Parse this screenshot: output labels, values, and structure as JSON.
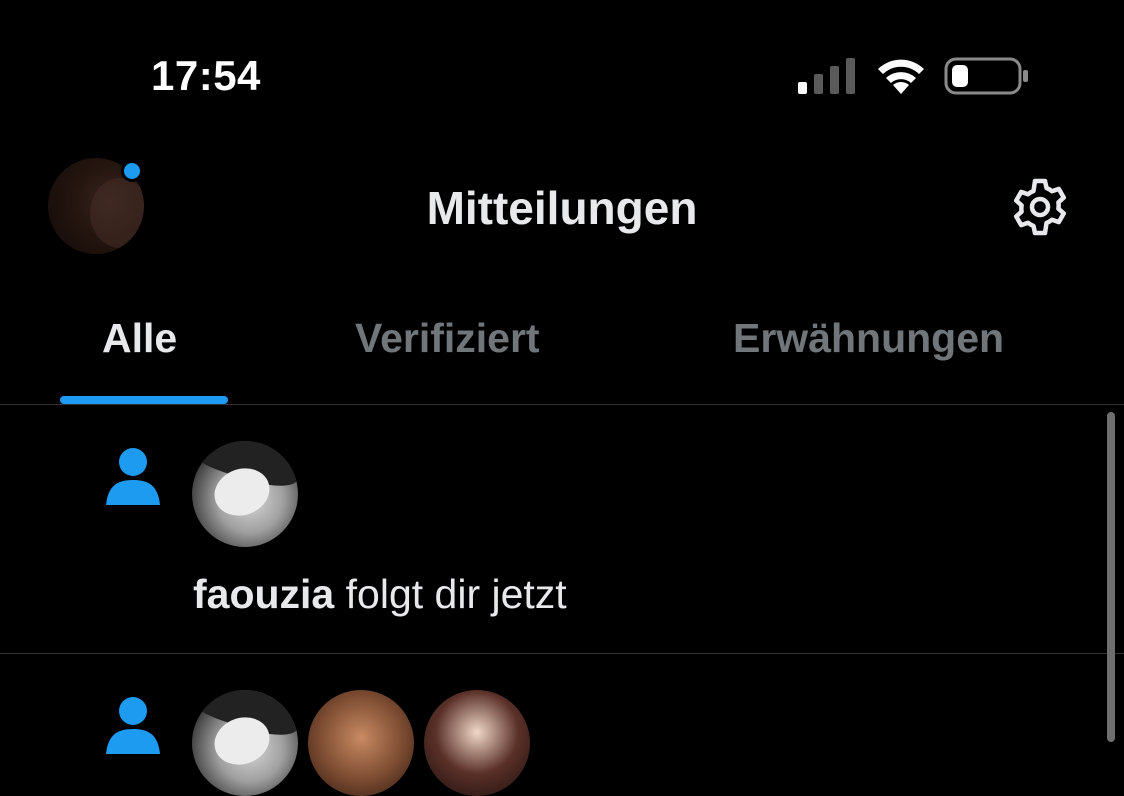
{
  "status_bar": {
    "time": "17:54",
    "signal_icon": "cellular-signal-icon",
    "wifi_icon": "wifi-icon",
    "battery_icon": "battery-icon",
    "battery_level": 0.2
  },
  "header": {
    "title": "Mitteilungen",
    "settings_icon": "gear-icon",
    "has_unread_dot": true
  },
  "tabs": [
    {
      "label": "Alle",
      "active": true
    },
    {
      "label": "Verifiziert",
      "active": false
    },
    {
      "label": "Erwähnungen",
      "active": false
    }
  ],
  "notifications": [
    {
      "type": "follow",
      "icon": "person-icon",
      "user": "faouzia",
      "text": " folgt dir jetzt"
    },
    {
      "type": "follow-group",
      "icon": "person-icon",
      "avatars": 3
    }
  ],
  "colors": {
    "accent": "#1d9bf0",
    "background": "#000000",
    "text_primary": "#e7e9ea",
    "text_secondary": "#71767b",
    "divider": "#2f3336"
  }
}
